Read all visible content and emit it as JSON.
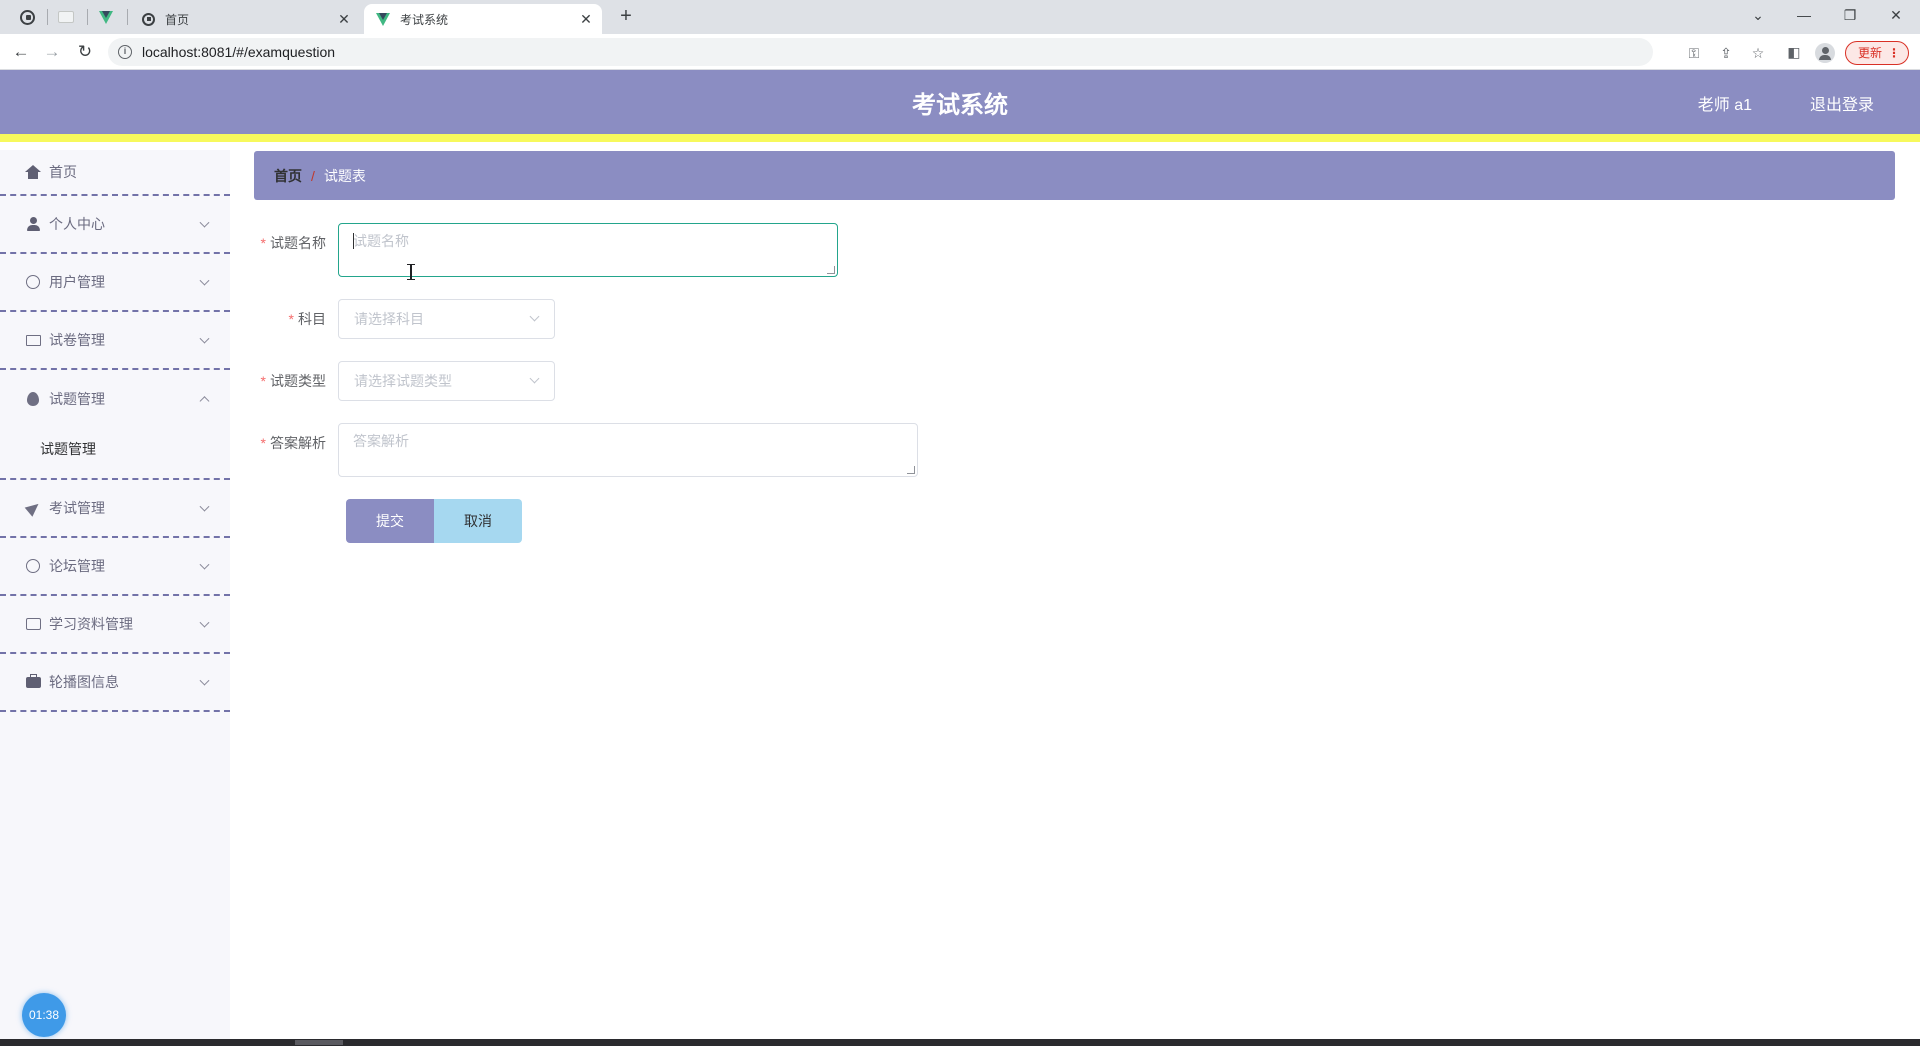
{
  "browser": {
    "tabs": [
      {
        "title": "首页",
        "active": false
      },
      {
        "title": "考试系统",
        "active": true
      }
    ],
    "url": "localhost:8081/#/examquestion",
    "update_label": "更新"
  },
  "header": {
    "title": "考试系统",
    "user": "老师 a1",
    "logout": "退出登录"
  },
  "sidebar": {
    "items": [
      {
        "label": "首页",
        "icon": "home-icon"
      },
      {
        "label": "个人中心",
        "icon": "user-icon"
      },
      {
        "label": "用户管理",
        "icon": "gauge-icon"
      },
      {
        "label": "试卷管理",
        "icon": "document-icon"
      },
      {
        "label": "试题管理",
        "icon": "drop-icon",
        "expanded": true,
        "children": [
          "试题管理"
        ]
      },
      {
        "label": "考试管理",
        "icon": "send-icon"
      },
      {
        "label": "论坛管理",
        "icon": "globe-icon"
      },
      {
        "label": "学习资料管理",
        "icon": "chat-icon"
      },
      {
        "label": "轮播图信息",
        "icon": "briefcase-icon"
      }
    ]
  },
  "timer": "01:38",
  "breadcrumb": {
    "home": "首页",
    "separator": "/",
    "current": "试题表"
  },
  "form": {
    "required_mark": "*",
    "name": {
      "label": "试题名称",
      "placeholder": "试题名称",
      "value": ""
    },
    "subject": {
      "label": "科目",
      "placeholder": "请选择科目"
    },
    "type": {
      "label": "试题类型",
      "placeholder": "请选择试题类型"
    },
    "analysis": {
      "label": "答案解析",
      "placeholder": "答案解析",
      "value": ""
    },
    "submit": "提交",
    "cancel": "取消"
  },
  "colors": {
    "header_bg": "#8b8dc2",
    "header_border": "#f7f95c",
    "menu_divider": "#7272a8",
    "focus_border": "#23a58c",
    "cancel_bg": "#a6d8f0"
  }
}
